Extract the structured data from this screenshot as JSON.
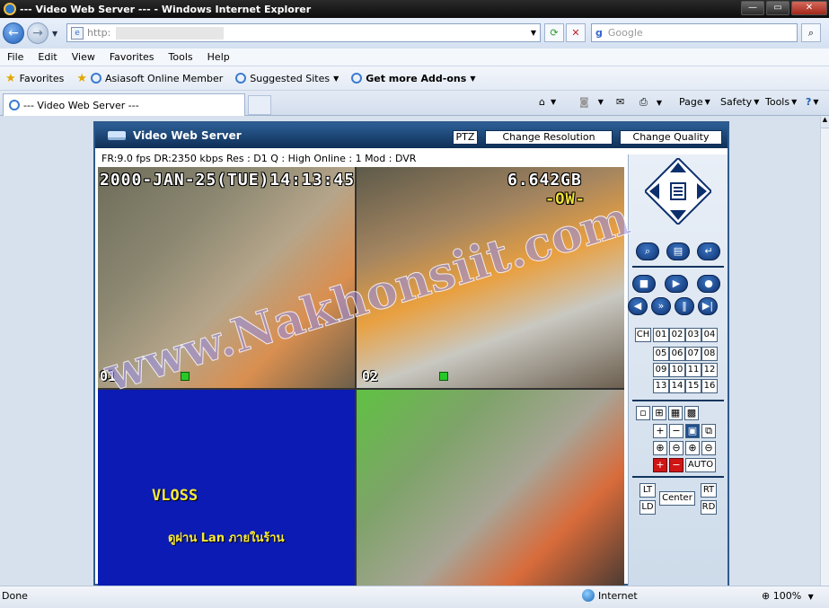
{
  "window": {
    "title": "--- Video Web Server --- - Windows Internet Explorer"
  },
  "address": {
    "url": "http:",
    "search_placeholder": "Google"
  },
  "menu": [
    "File",
    "Edit",
    "View",
    "Favorites",
    "Tools",
    "Help"
  ],
  "favorites": {
    "label": "Favorites",
    "items": [
      "Asiasoft Online Member",
      "Suggested Sites",
      "Get more Add-ons"
    ]
  },
  "tab": {
    "title": "--- Video Web Server ---"
  },
  "command_bar": {
    "page": "Page",
    "safety": "Safety",
    "tools": "Tools"
  },
  "app": {
    "name": "Video Web Server",
    "buttons": {
      "ptz": "PTZ",
      "resolution": "Change Resolution",
      "quality": "Change Quality"
    },
    "status": "FR:9.0 fps  DR:2350 kbps   Res : D1  Q : High  Online : 1 Mod : DVR",
    "osd": {
      "datetime": "2000-JAN-25(TUE)14:13:45",
      "disk": "6.642GB",
      "mode": "-OW-"
    },
    "cams": [
      "01",
      "02"
    ],
    "vloss": "VLOSS",
    "thai_text": "ดูผ่าน Lan ภายในร้าน",
    "watermark": "www.Nakhonsiit.com",
    "channels": {
      "label": "CH",
      "numbers": [
        "01",
        "02",
        "03",
        "04",
        "05",
        "06",
        "07",
        "08",
        "09",
        "10",
        "11",
        "12",
        "13",
        "14",
        "15",
        "16"
      ]
    },
    "auto": "AUTO",
    "ptz": {
      "lt": "LT",
      "ld": "LD",
      "center": "Center",
      "rt": "RT",
      "rd": "RD"
    }
  },
  "statusbar": {
    "left": "Done",
    "zone": "Internet",
    "zoom": "100%"
  }
}
